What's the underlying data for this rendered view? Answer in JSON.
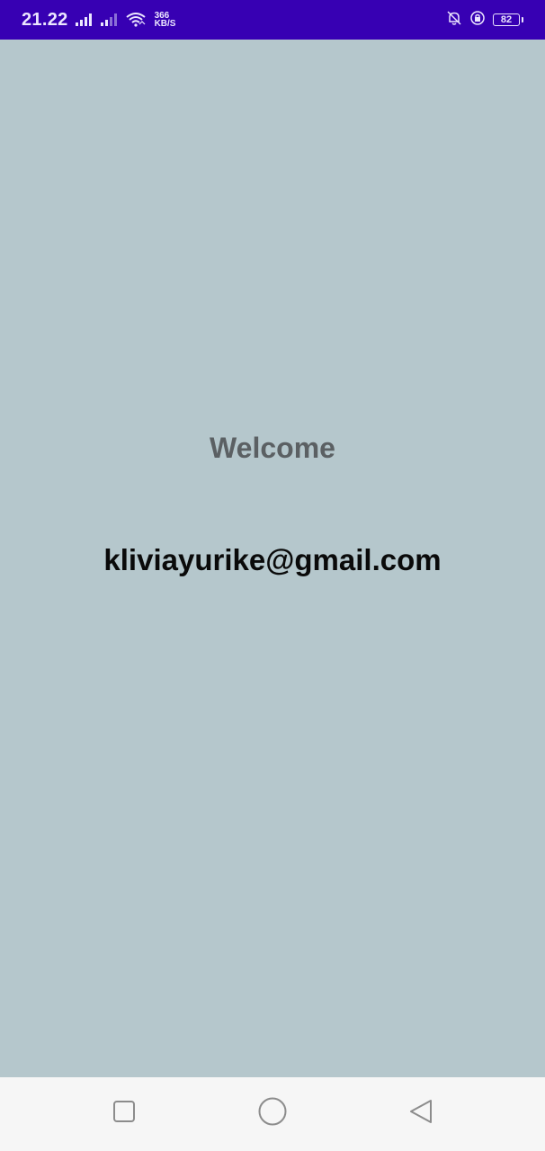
{
  "status_bar": {
    "time": "21.22",
    "net_speed_value": "366",
    "net_speed_unit": "KB/S",
    "battery_level": "82",
    "icons": [
      "signal-icon",
      "signal-icon",
      "wifi-icon",
      "mute-notifications-icon",
      "data-saver-icon",
      "battery-icon"
    ],
    "colors": {
      "background": "#3700b3",
      "foreground": "#ece6ff"
    }
  },
  "main": {
    "welcome_text": "Welcome",
    "email_text": "kliviayurike@gmail.com",
    "colors": {
      "background": "#b5c7cc",
      "welcome": "#5b6063",
      "email": "#0a0a0a"
    }
  },
  "nav_bar": {
    "buttons": [
      "recents-icon",
      "home-icon",
      "back-icon"
    ],
    "colors": {
      "background": "#f6f6f6",
      "icon": "#8c8c8c"
    }
  }
}
